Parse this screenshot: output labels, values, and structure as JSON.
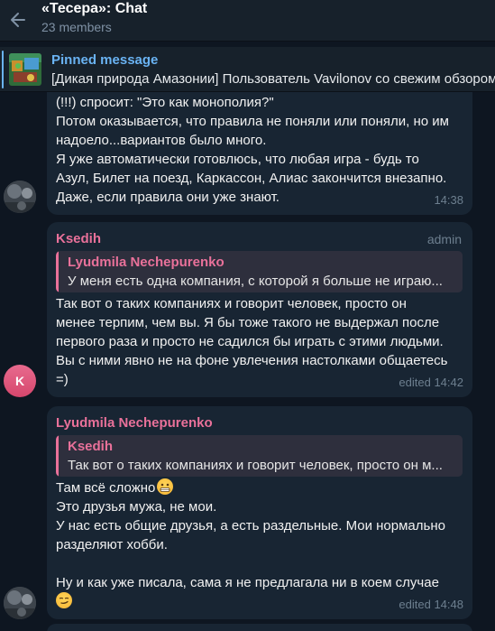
{
  "header": {
    "title": "«Тесера»: Chat",
    "subtitle": "23 members"
  },
  "pinned": {
    "title": "Pinned message",
    "text": "[Дикая природа Амазонии] Пользователь Vavilonov со свежим обзором"
  },
  "messages": [
    {
      "lines": [
        "(!!!) спросит: \"Это как монополия?\"",
        "Потом оказывается, что правила не поняли или поняли, но им",
        "надоело...вариантов было много.",
        "Я уже автоматически готовлюсь, что любая игра - будь то",
        "Азул, Билет на поезд, Каркассон, Алиас закончится внезапно.",
        "Даже, если правила они уже знают."
      ],
      "time": "14:38"
    },
    {
      "sender": "Ksedih",
      "sender_avatar_letter": "K",
      "badge": "admin",
      "reply_name": "Lyudmila Nechepurenko",
      "reply_text": "У меня есть одна компания, с которой я больше не играю...",
      "lines": [
        "Так вот о таких компаниях и говорит человек, просто он",
        "менее терпим, чем вы. Я бы тоже такого не выдержал после",
        "первого раза и просто не садился бы играть с этими людьми.",
        "Вы с ними явно не на фоне увлечения настолками общаетесь",
        "=)"
      ],
      "time": "edited 14:42"
    },
    {
      "sender": "Lyudmila Nechepurenko",
      "reply_name": "Ksedih",
      "reply_text": "Так вот о таких компаниях и говорит человек, просто он м...",
      "lines": [
        "Там всё сложно",
        "Это друзья мужа, не мои.",
        "У нас есть общие друзья, а есть раздельные. Мои нормально",
        "разделяют хобби.",
        "",
        "Ну и как уже писала, сама я не предлагала ни в коем случае"
      ],
      "emojis": [
        "grimacing-face",
        "smirking-face"
      ],
      "time": "edited 14:48"
    }
  ],
  "colors": {
    "background": "#0e1621",
    "bubble": "#182533",
    "accent": "#6ab3f3",
    "sender_name": "#e9719a"
  }
}
